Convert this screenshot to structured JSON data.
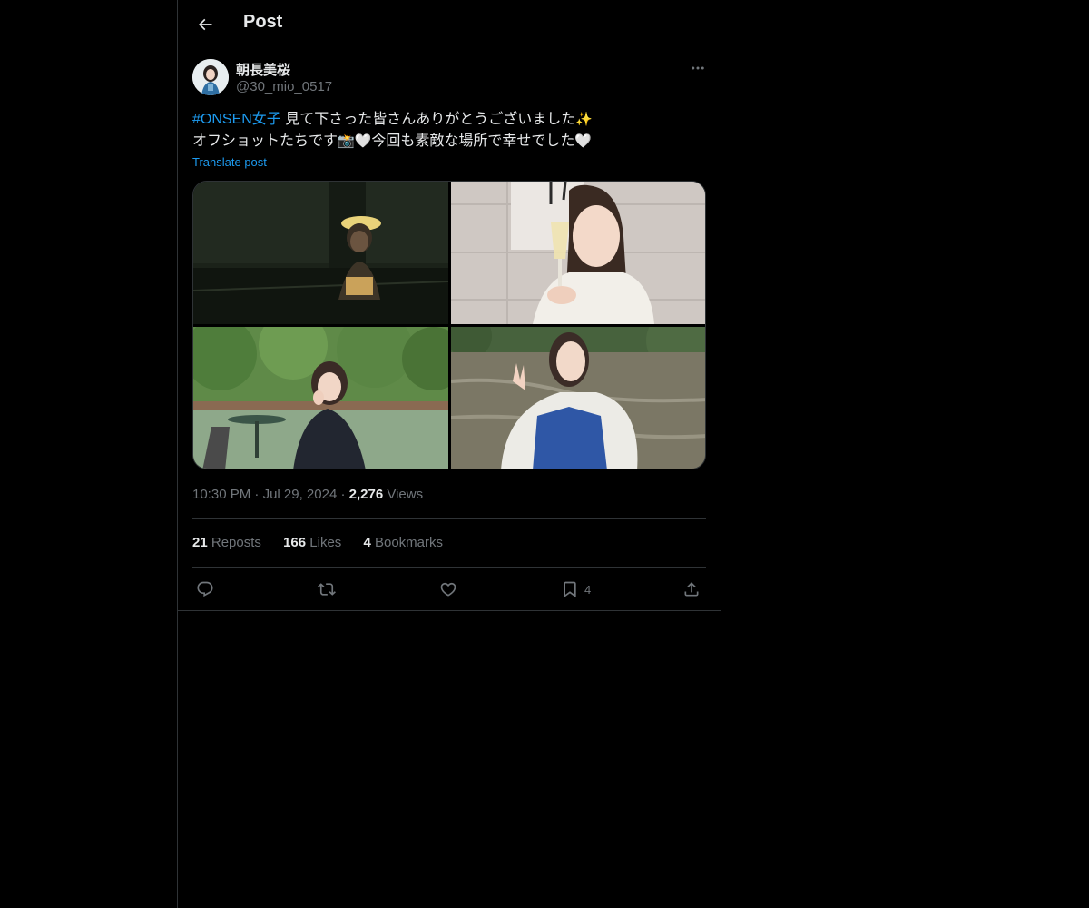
{
  "header": {
    "title": "Post",
    "back_icon": "arrow-left-icon"
  },
  "author": {
    "display_name": "朝長美桜",
    "handle": "@30_mio_0517",
    "more_icon": "more-horizontal-icon"
  },
  "post": {
    "hashtag": "#ONSEN女子",
    "line1_text": " 見て下さった皆さんありがとうございました",
    "line1_emoji": "✨",
    "line2_text_a": "オフショットたちです",
    "line2_emoji_a": "📸",
    "line2_emoji_b": "🤍",
    "line2_text_b": "今回も素敵な場所で幸せでした",
    "line2_emoji_c": "🤍",
    "translate_label": "Translate post"
  },
  "media": {
    "photos": [
      "photo-dim-hotel-room",
      "photo-glass-of-champagne",
      "photo-lakeside-terrace",
      "photo-boat-on-river"
    ]
  },
  "meta": {
    "time": "10:30 PM",
    "separator": "·",
    "date": "Jul 29, 2024",
    "views_count": "2,276",
    "views_label": "Views"
  },
  "stats": {
    "reposts_count": "21",
    "reposts_label": "Reposts",
    "likes_count": "166",
    "likes_label": "Likes",
    "bookmarks_count": "4",
    "bookmarks_label": "Bookmarks"
  },
  "actions": {
    "reply_icon": "reply-icon",
    "repost_icon": "repost-icon",
    "like_icon": "heart-icon",
    "bookmark_icon": "bookmark-icon",
    "bookmark_count": "4",
    "share_icon": "share-icon"
  },
  "colors": {
    "background": "#000000",
    "accent": "#1d9bf0",
    "text": "#e7e9ea",
    "muted": "#71767b",
    "border": "#2f3336"
  }
}
